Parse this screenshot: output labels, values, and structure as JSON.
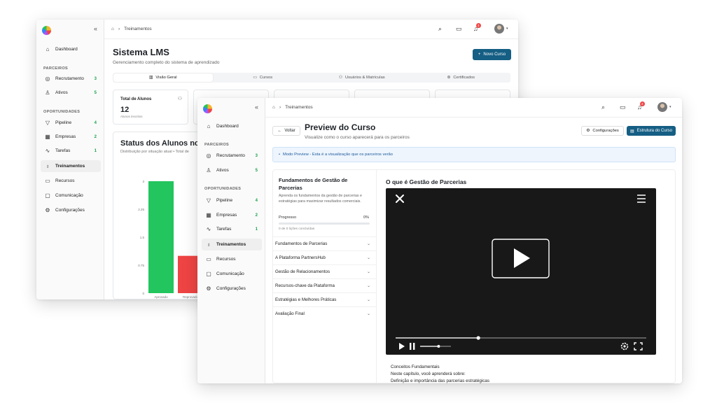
{
  "back_window": {
    "sidebar": {
      "dashboard": "Dashboard",
      "section_parceiros": "PARCEIROS",
      "recrutamento": {
        "label": "Recrutamento",
        "badge": "3"
      },
      "ativos": {
        "label": "Ativos",
        "badge": "5"
      },
      "section_oportunidades": "OPORTUNIDADES",
      "pipeline": {
        "label": "Pipeline",
        "badge": "4"
      },
      "empresas": {
        "label": "Empresas",
        "badge": "2"
      },
      "tarefas": {
        "label": "Tarefas",
        "badge": "1"
      },
      "treinamentos": "Treinamentos",
      "recursos": "Recursos",
      "comunicacao": "Comunicação",
      "configuracoes": "Configurações"
    },
    "topbar": {
      "breadcrumb": "Treinamentos",
      "notification_count": "3"
    },
    "header": {
      "title": "Sistema LMS",
      "subtitle": "Gerenciamento completo do sistema de aprendizado",
      "new_course_button": "Novo Curso"
    },
    "tabs": [
      "Visão Geral",
      "Cursos",
      "Usuários & Matrículas",
      "Certificados"
    ],
    "stat_card": {
      "title": "Total de Alunos",
      "value": "12",
      "note": "Alunos inscritos"
    },
    "chart": {
      "title": "Status dos Alunos no Cu",
      "subtitle": "Distribuição por situação atual • Total de",
      "colors": {
        "aprovado": "#22c55e",
        "reprovado": "#ef4444"
      }
    }
  },
  "front_window": {
    "sidebar": {
      "dashboard": "Dashboard",
      "section_parceiros": "PARCEIROS",
      "recrutamento": {
        "label": "Recrutamento",
        "badge": "3"
      },
      "ativos": {
        "label": "Ativos",
        "badge": "5"
      },
      "section_oportunidades": "OPORTUNIDADES",
      "pipeline": {
        "label": "Pipeline",
        "badge": "4"
      },
      "empresas": {
        "label": "Empresas",
        "badge": "2"
      },
      "tarefas": {
        "label": "Tarefas",
        "badge": "1"
      },
      "treinamentos": "Treinamentos",
      "recursos": "Recursos",
      "comunicacao": "Comunicação",
      "configuracoes": "Configurações"
    },
    "topbar": {
      "breadcrumb": "Treinamentos",
      "notification_count": "3"
    },
    "header": {
      "back_label": "Voltar",
      "title": "Preview do Curso",
      "subtitle": "Visualize como o curso aparecerá para os parceiros",
      "config_button": "Configurações",
      "structure_button": "Estrutura do Curso"
    },
    "info_bar": "Modo Preview - Esta é a visualização que os parceiros verão",
    "course": {
      "title": "Fundamentos de Gestão de Parcerias",
      "description": "Aprenda os fundamentos da gestão de parcerias e estratégias para maximizar resultados comerciais.",
      "progress_label": "Progresso",
      "progress_pct": "0%",
      "progress_value": 0,
      "progress_note": "0 de 0 lições concluídas",
      "modules": [
        "Fundamentos de Parcerias",
        "A Plataforma PartnersHub",
        "Gestão de Relacionamentos",
        "Recursos-chave da Plataforma",
        "Estratégias e Melhores Práticas",
        "Avaliação Final"
      ]
    },
    "lesson": {
      "title": "O que é Gestão de Parcerias",
      "video_progress": 0.33,
      "volume_level": 0.6,
      "text_lines": [
        "Conceitos Fundamentais",
        "Neste capítulo, você aprenderá sobre:",
        "Definição e importância das parcerias estratégicas"
      ]
    }
  },
  "chart_data": {
    "type": "bar",
    "categories": [
      "Aprovado",
      "Reprovado"
    ],
    "values": [
      3,
      1
    ],
    "ylim": [
      0,
      3
    ],
    "yticks": [
      "0",
      "0.75",
      "1.5",
      "2.25",
      "3"
    ],
    "title": "Status dos Alunos no Cu",
    "grid": false
  }
}
